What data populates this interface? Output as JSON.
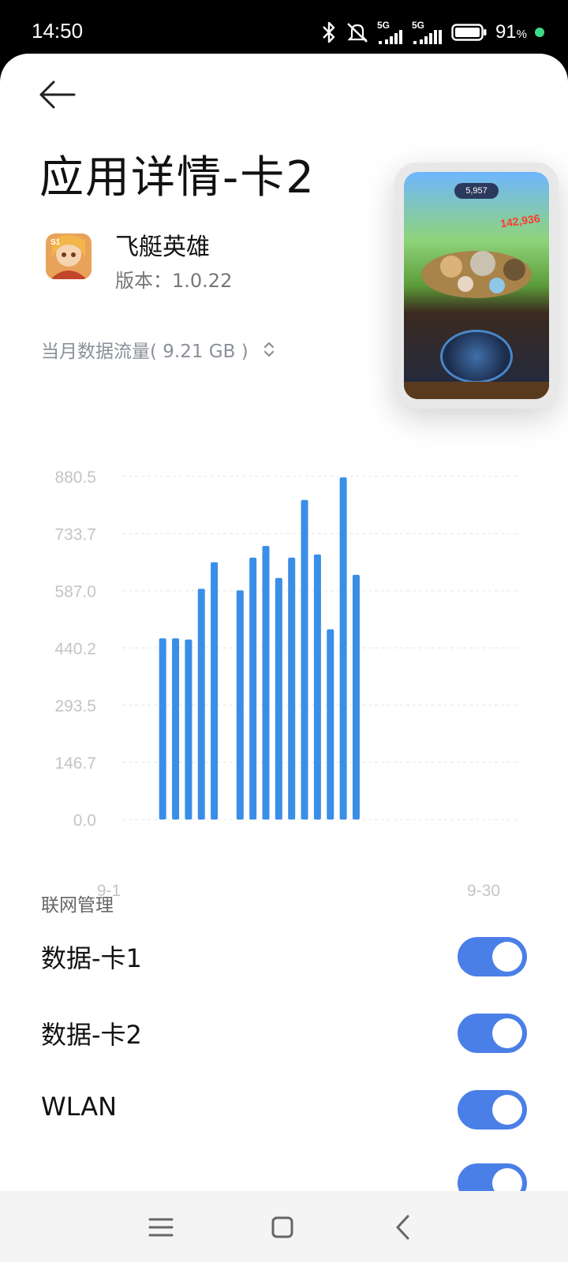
{
  "status_bar": {
    "time": "14:50",
    "signal1_label": "5G",
    "signal2_label": "5G",
    "battery": "91",
    "battery_unit": "%"
  },
  "header": {
    "title": "应用详情-卡2"
  },
  "app": {
    "name": "飞艇英雄",
    "version": "版本：1.0.22"
  },
  "usage": {
    "label": "当月数据流量( 9.21 GB )"
  },
  "pip": {
    "score": "5,957",
    "damage": "142,936"
  },
  "chart_data": {
    "type": "bar",
    "ylim": [
      0,
      880.5
    ],
    "yticks": [
      "880.5",
      "733.7",
      "587.0",
      "440.2",
      "293.5",
      "146.7",
      "0.0"
    ],
    "yticks_values": [
      880.5,
      733.7,
      587.0,
      440.2,
      293.5,
      146.7,
      0.0
    ],
    "xtick_first": "9-1",
    "xtick_last": "9-30",
    "days": 30,
    "values": [
      0,
      0,
      465,
      465,
      462,
      592,
      660,
      0,
      588,
      672,
      702,
      620,
      672,
      820,
      680,
      488,
      878,
      628,
      0,
      0,
      0,
      0,
      0,
      0,
      0,
      0,
      0,
      0,
      0,
      0
    ],
    "grid": true,
    "bar_color": "#3a8ee8"
  },
  "network": {
    "section_label": "联网管理",
    "items": [
      {
        "label": "数据-卡1",
        "on": true
      },
      {
        "label": "数据-卡2",
        "on": true
      },
      {
        "label": "WLAN",
        "on": true
      }
    ]
  },
  "colors": {
    "accent": "#4a7fe8"
  }
}
